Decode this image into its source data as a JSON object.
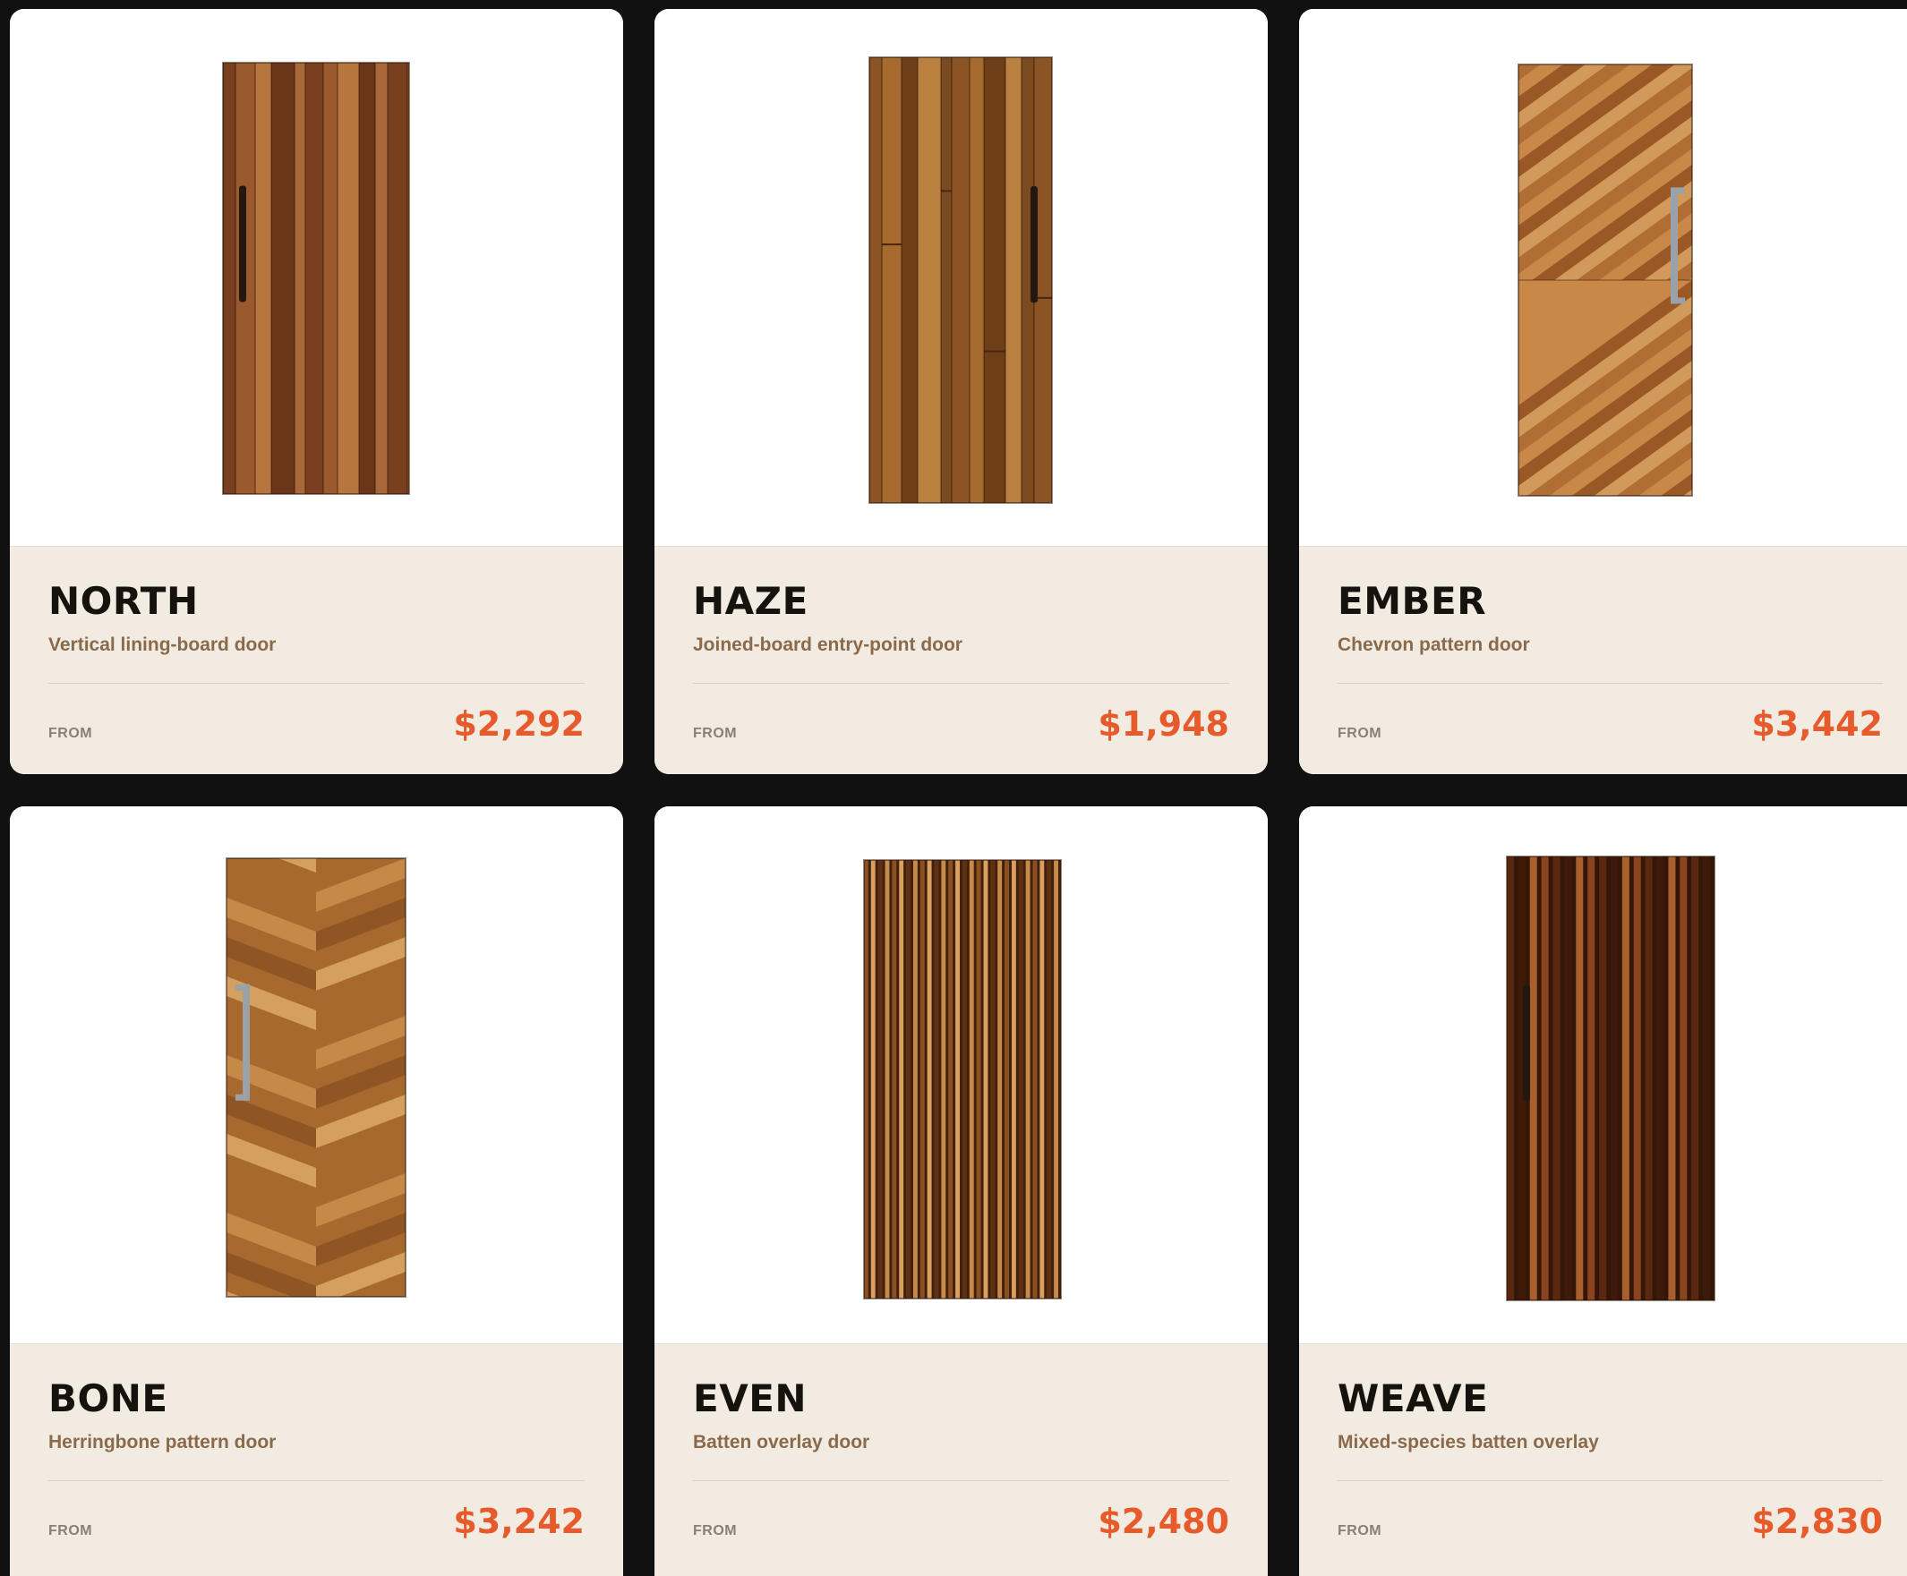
{
  "products": [
    {
      "name": "NORTH",
      "description": "Vertical lining-board door",
      "from_label": "FROM",
      "price": "$2,292",
      "style": "vertical",
      "colors": [
        "#7a3f1e",
        "#9a5a2e",
        "#b8763f",
        "#6b3518",
        "#a8683a"
      ],
      "handle": "dark-bar-left"
    },
    {
      "name": "HAZE",
      "description": "Joined-board entry-point door",
      "from_label": "FROM",
      "price": "$1,948",
      "style": "joined",
      "colors": [
        "#8a5424",
        "#a66a2e",
        "#6e3e18",
        "#b9803f",
        "#7a4a20"
      ],
      "handle": "dark-bar-right"
    },
    {
      "name": "EMBER",
      "description": "Chevron pattern door",
      "from_label": "FROM",
      "price": "$3,442",
      "style": "chevron",
      "colors": [
        "#b06d34",
        "#c98848",
        "#9a5826",
        "#d19a5a"
      ],
      "handle": "steel-bar-right"
    },
    {
      "name": "BONE",
      "description": "Herringbone pattern door",
      "from_label": "FROM",
      "price": "$3,242",
      "style": "herringbone",
      "colors": [
        "#a8692f",
        "#c58a47",
        "#8f5524",
        "#d4a060"
      ],
      "handle": "steel-bar-left"
    },
    {
      "name": "EVEN",
      "description": "Batten overlay door",
      "from_label": "FROM",
      "price": "$2,480",
      "style": "battens",
      "colors": [
        "#8a4f22",
        "#c88a48",
        "#5e3014",
        "#d9a061"
      ],
      "handle": "none"
    },
    {
      "name": "WEAVE",
      "description": "Mixed-species batten overlay",
      "from_label": "FROM",
      "price": "$2,830",
      "style": "battens-dark",
      "colors": [
        "#5a2810",
        "#8a4520",
        "#a8602e",
        "#3e1a0a"
      ],
      "handle": "dark-bar-left"
    }
  ]
}
